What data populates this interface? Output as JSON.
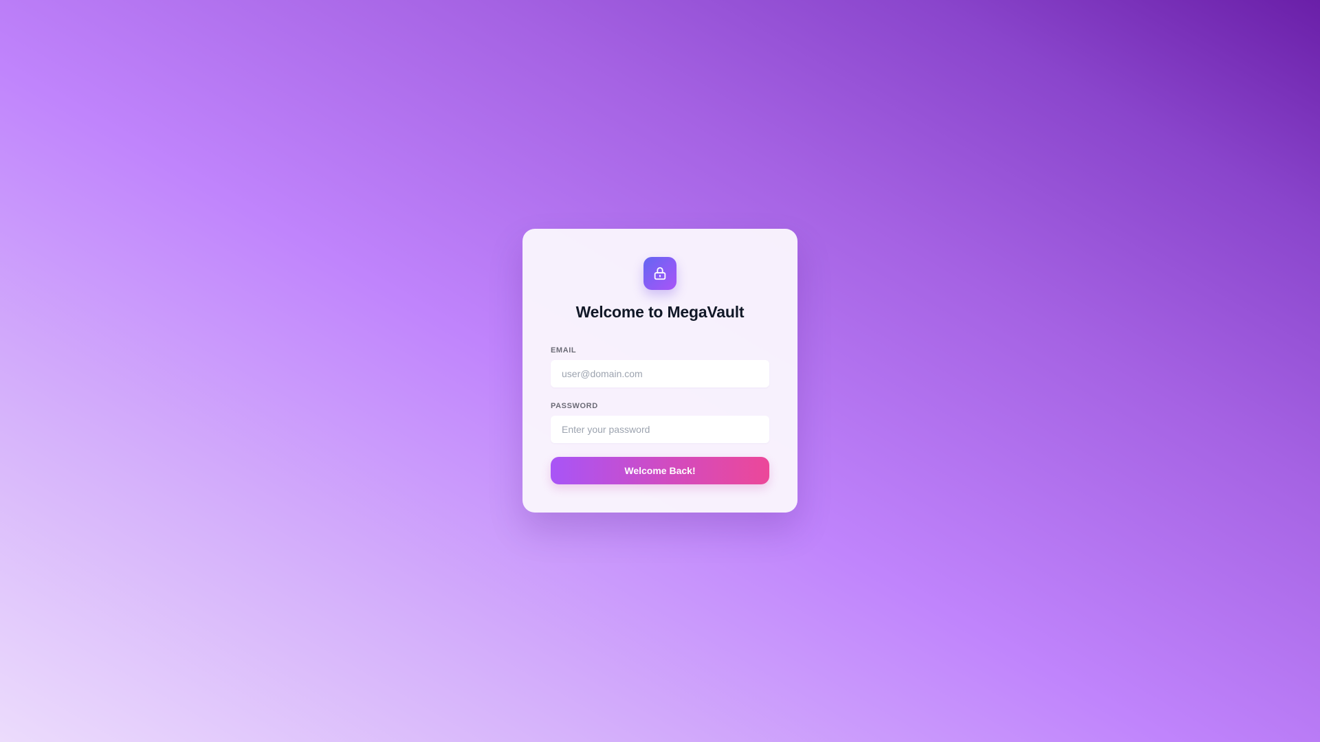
{
  "login": {
    "title": "Welcome to MegaVault",
    "icon": "lock-icon",
    "email": {
      "label": "EMAIL",
      "placeholder": "user@domain.com",
      "value": ""
    },
    "password": {
      "label": "PASSWORD",
      "placeholder": "Enter your password",
      "value": ""
    },
    "submit_label": "Welcome Back!"
  },
  "colors": {
    "background_light": "#ecdcfc",
    "background_mid": "#c084fc",
    "background_dark": "#6a1fa8",
    "icon_gradient_start": "#6366f1",
    "icon_gradient_end": "#a855f7",
    "button_gradient_start": "#a855f7",
    "button_gradient_end": "#ec4899",
    "title_text": "#111827"
  }
}
